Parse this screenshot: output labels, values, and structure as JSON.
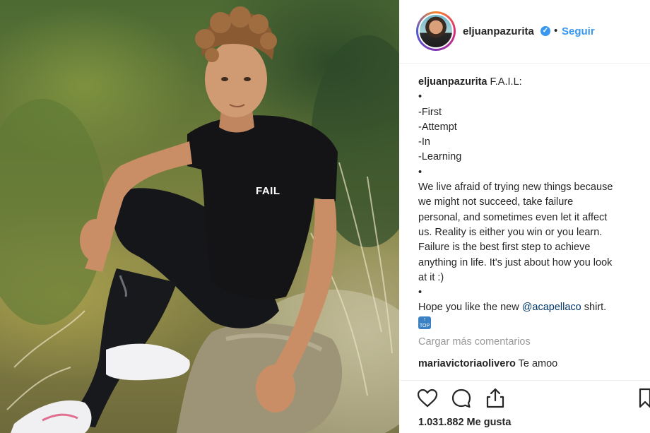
{
  "post": {
    "username": "eljuanpazurita",
    "separator": "•",
    "follow_label": "Seguir",
    "photo_shirt_text": "FAIL",
    "caption_lines": [
      "•",
      "-First",
      "-Attempt",
      "-In",
      "-Learning",
      "•",
      "We live afraid of trying new things because",
      "we might not succeed, take failure",
      "personal, and sometimes even let it affect",
      "us. Reality is either you win or you learn.",
      "Failure is the best first step to achieve",
      "anything in life. It's just about how you look",
      "at it :)",
      "•"
    ],
    "caption_title": "F.A.I.L:",
    "caption_hope": "Hope you like the new ",
    "caption_mention": "@acapellaco",
    "caption_after_mention": " shirt.",
    "emoji_label": "TOP",
    "load_more_label": "Cargar más comentarios",
    "comment": {
      "username": "mariavictoriaolivero",
      "text": "Te amoo"
    },
    "likes_count": "1.031.882",
    "likes_label": "Me gusta"
  },
  "icons": {
    "verified": "verified-badge-icon",
    "like": "heart-icon",
    "comment": "comment-bubble-icon",
    "share": "share-icon",
    "save": "bookmark-icon"
  },
  "colors": {
    "link": "#3897f0",
    "muted": "#999999",
    "text": "#262626"
  }
}
